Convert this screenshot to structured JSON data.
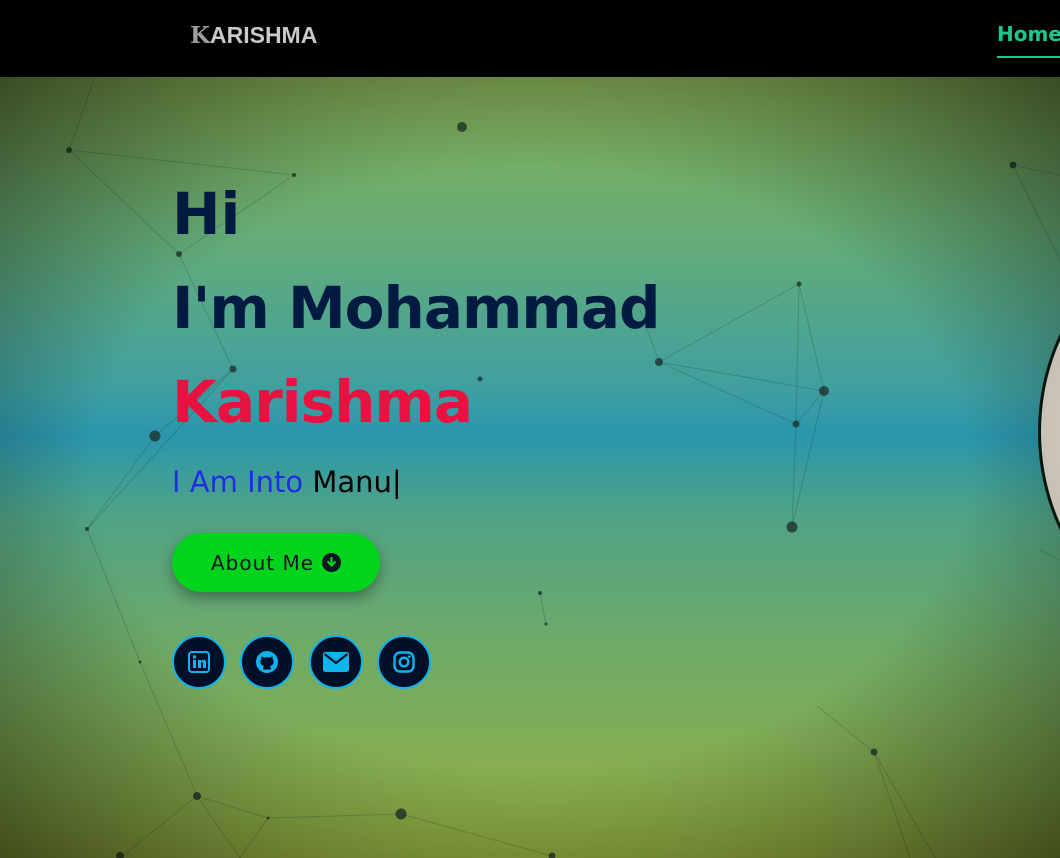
{
  "navbar": {
    "brand_first_letter": "K",
    "brand_rest": "ARISHMA",
    "home_label": "Home"
  },
  "hero": {
    "greeting": "Hi",
    "intro": "I'm Mohammad",
    "name": "Karishma",
    "typed_prefix": "I Am Into",
    "typed_word": "Manu",
    "typed_cursor": "|",
    "about_button_label": "About Me",
    "about_button_icon": "arrow-down-circle-icon"
  },
  "social_links": [
    {
      "name": "linkedin",
      "icon": "linkedin-icon"
    },
    {
      "name": "github",
      "icon": "github-icon"
    },
    {
      "name": "email",
      "icon": "envelope-icon"
    },
    {
      "name": "instagram",
      "icon": "instagram-icon"
    }
  ],
  "colors": {
    "nav_background": "#000000",
    "nav_active": "#19c98b",
    "heading": "#011a42",
    "name_accent": "#e8113f",
    "typed_prefix": "#1f2fe0",
    "button": "#02d41d",
    "social_border": "#0fb5ea",
    "social_background": "#020f28"
  }
}
